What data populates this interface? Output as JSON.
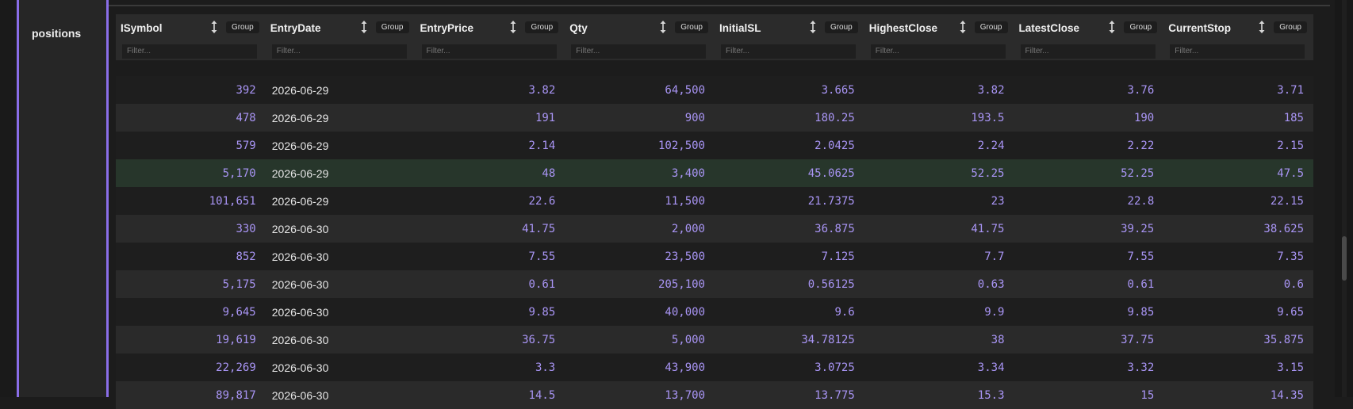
{
  "section_label": "positions",
  "columns": [
    {
      "name": "ISymbol",
      "group_label": "Group",
      "filter_placeholder": "Filter..."
    },
    {
      "name": "EntryDate",
      "group_label": "Group",
      "filter_placeholder": "Filter..."
    },
    {
      "name": "EntryPrice",
      "group_label": "Group",
      "filter_placeholder": "Filter..."
    },
    {
      "name": "Qty",
      "group_label": "Group",
      "filter_placeholder": "Filter..."
    },
    {
      "name": "InitialSL",
      "group_label": "Group",
      "filter_placeholder": "Filter..."
    },
    {
      "name": "HighestClose",
      "group_label": "Group",
      "filter_placeholder": "Filter..."
    },
    {
      "name": "LatestClose",
      "group_label": "Group",
      "filter_placeholder": "Filter..."
    },
    {
      "name": "CurrentStop",
      "group_label": "Group",
      "filter_placeholder": "Filter..."
    }
  ],
  "rows": [
    [
      "392",
      "2026-06-29",
      "3.82",
      "64,500",
      "3.665",
      "3.82",
      "3.76",
      "3.71"
    ],
    [
      "478",
      "2026-06-29",
      "191",
      "900",
      "180.25",
      "193.5",
      "190",
      "185"
    ],
    [
      "579",
      "2026-06-29",
      "2.14",
      "102,500",
      "2.0425",
      "2.24",
      "2.22",
      "2.15"
    ],
    [
      "5,170",
      "2026-06-29",
      "48",
      "3,400",
      "45.0625",
      "52.25",
      "52.25",
      "47.5"
    ],
    [
      "101,651",
      "2026-06-29",
      "22.6",
      "11,500",
      "21.7375",
      "23",
      "22.8",
      "22.15"
    ],
    [
      "330",
      "2026-06-30",
      "41.75",
      "2,000",
      "36.875",
      "41.75",
      "39.25",
      "38.625"
    ],
    [
      "852",
      "2026-06-30",
      "7.55",
      "23,500",
      "7.125",
      "7.7",
      "7.55",
      "7.35"
    ],
    [
      "5,175",
      "2026-06-30",
      "0.61",
      "205,100",
      "0.56125",
      "0.63",
      "0.61",
      "0.6"
    ],
    [
      "9,645",
      "2026-06-30",
      "9.85",
      "40,000",
      "9.6",
      "9.9",
      "9.85",
      "9.65"
    ],
    [
      "19,619",
      "2026-06-30",
      "36.75",
      "5,000",
      "34.78125",
      "38",
      "37.75",
      "35.875"
    ],
    [
      "22,269",
      "2026-06-30",
      "3.3",
      "43,900",
      "3.0725",
      "3.34",
      "3.32",
      "3.15"
    ],
    [
      "89,817",
      "2026-06-30",
      "14.5",
      "13,700",
      "13.775",
      "15.3",
      "15",
      "14.35"
    ]
  ],
  "highlighted_row": 3,
  "colors": {
    "accent": "#8a6ee8",
    "number_text": "#a995f5",
    "highlight_row": "#27362b"
  },
  "icons": {
    "sort": "sort-up-down-icon"
  }
}
